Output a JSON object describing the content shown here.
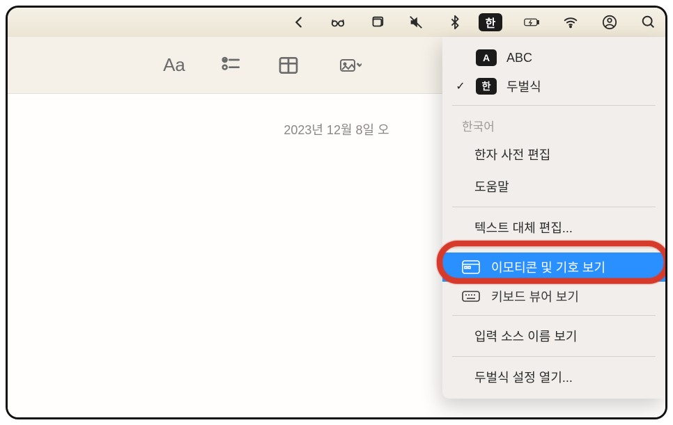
{
  "menubar": {
    "input_badge": "한"
  },
  "toolbar": {
    "aa_label": "Aa"
  },
  "content": {
    "date_stamp": "2023년 12월 8일 오"
  },
  "dropdown": {
    "abc_badge": "A",
    "abc_label": "ABC",
    "han_badge": "한",
    "han_label": "두벌식",
    "section_korean": "한국어",
    "hanja_dict": "한자 사전 편집",
    "help": "도움말",
    "text_replace": "텍스트 대체 편집...",
    "emoji_symbols": "이모티콘 및 기호 보기",
    "keyboard_viewer": "키보드 뷰어 보기",
    "show_input_name": "입력 소스 이름 보기",
    "open_settings": "두벌식 설정 열기..."
  }
}
